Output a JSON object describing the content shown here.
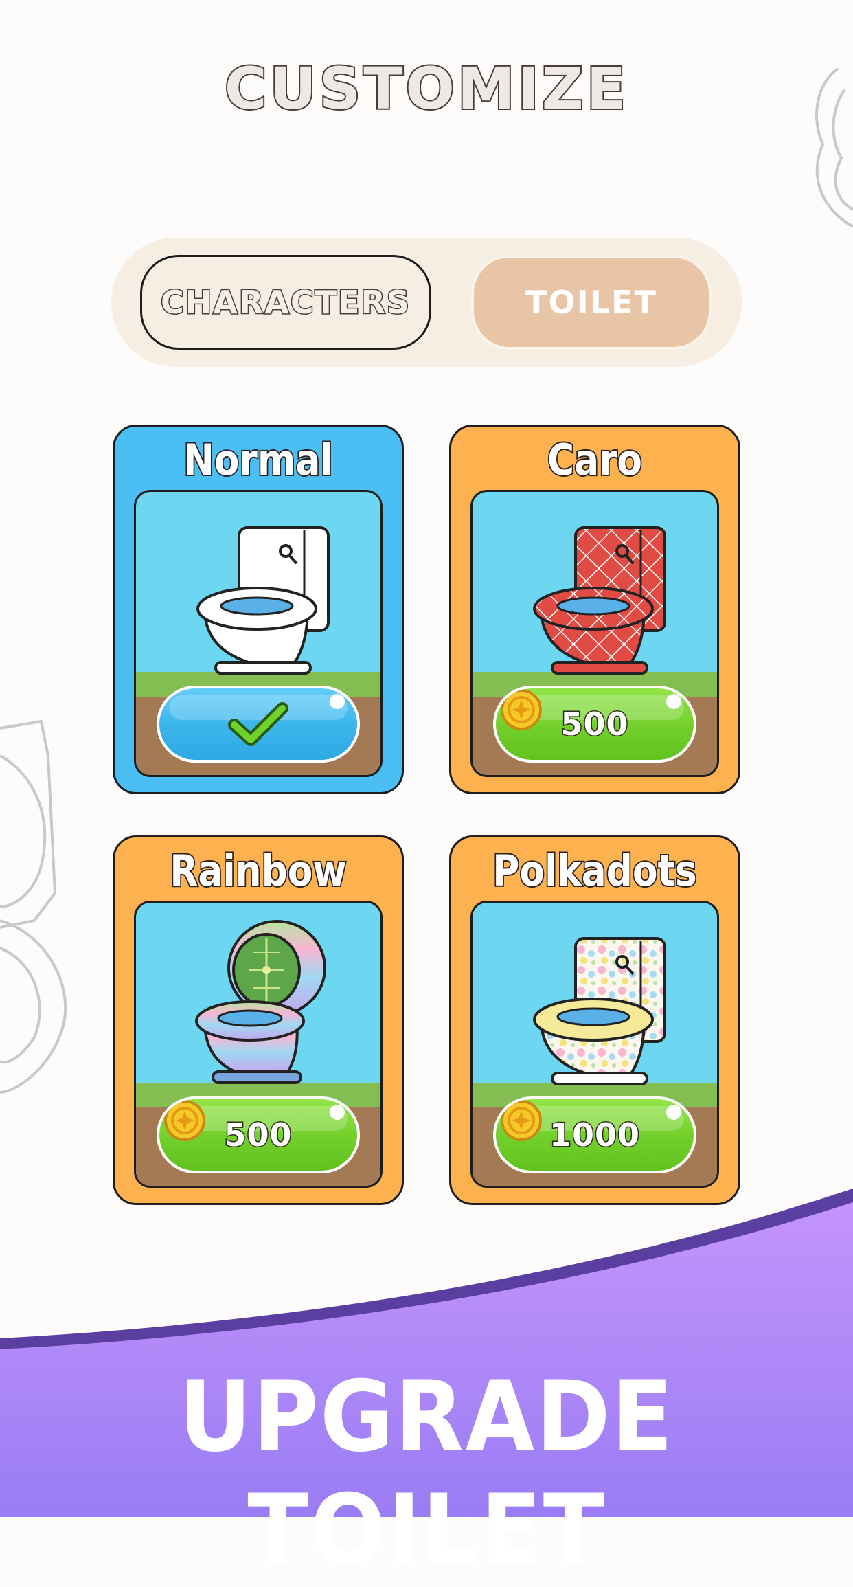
{
  "header": {
    "title": "CUSTOMIZE"
  },
  "tabs": [
    {
      "label": "CHARACTERS",
      "active": false
    },
    {
      "label": "TOILET",
      "active": true
    }
  ],
  "items": [
    {
      "name": "Normal",
      "state": "selected",
      "icon": "checkmark-icon"
    },
    {
      "name": "Caro",
      "state": "locked",
      "price": "500",
      "icon": "coin-icon"
    },
    {
      "name": "Rainbow",
      "state": "locked",
      "price": "500",
      "icon": "coin-icon"
    },
    {
      "name": "Polkadots",
      "state": "locked",
      "price": "1000",
      "icon": "coin-icon"
    }
  ],
  "banner": {
    "text": "UPGRADE TOILET"
  },
  "colors": {
    "selected_card": "#4bbff3",
    "locked_card": "#fdb24f",
    "buy_button": "#72cf2b",
    "equip_button": "#3cb6ec",
    "banner": "#a98af8",
    "active_tab": "#e8c5a7"
  }
}
